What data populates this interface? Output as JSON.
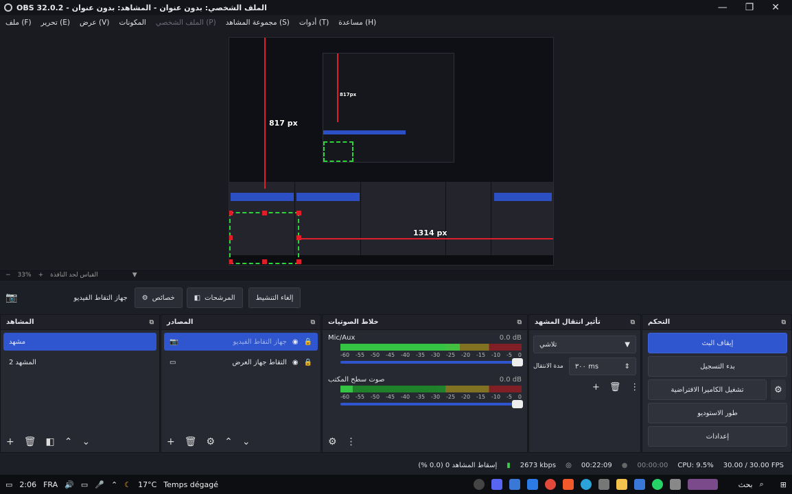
{
  "window": {
    "title": "OBS 32.0.2 - الملف الشخصي: بدون عنوان - المشاهد: بدون عنوان",
    "minimize": "—",
    "maximize": "❐",
    "close": "✕"
  },
  "menu": [
    {
      "label": "ملف (F)",
      "disabled": false
    },
    {
      "label": "تحرير (E)",
      "disabled": false
    },
    {
      "label": "عرض (V)",
      "disabled": false
    },
    {
      "label": "المكونات",
      "disabled": false
    },
    {
      "label": "الملف الشخصي (P)",
      "disabled": true
    },
    {
      "label": "مجموعة المشاهد (S)",
      "disabled": false
    },
    {
      "label": "أدوات (T)",
      "disabled": false
    },
    {
      "label": "مساعدة (H)",
      "disabled": false
    }
  ],
  "preview": {
    "measure_vertical": "817 px",
    "measure_horizontal": "1314 px",
    "inner_measure": "817px"
  },
  "zoom": {
    "minus": "−",
    "value": "33%",
    "plus": "+",
    "fit_label": "القياس لحد النافذة",
    "dropdown": "▼"
  },
  "source_toolbar": {
    "source_name": "جهاز التقاط الفيديو",
    "properties": "خصائص",
    "filters": "المرشحات",
    "deactivate": "إلغاء التنشيط"
  },
  "scenes": {
    "title": "المشاهد",
    "items": [
      {
        "label": "مشهد",
        "selected": true
      },
      {
        "label": "المشهد 2",
        "selected": false
      }
    ]
  },
  "sources": {
    "title": "المصادر",
    "items": [
      {
        "label": "جهاز التقاط الفيديو",
        "selected": true
      },
      {
        "label": "التقاط جهاز العرض",
        "selected": false
      }
    ]
  },
  "mixer": {
    "title": "خلاط الصوتيات",
    "tracks": [
      {
        "name": "Mic/Aux",
        "db": "0.0 dB",
        "level": 0.66
      },
      {
        "name": "صوت سطح المكتب",
        "db": "0.0 dB",
        "level": 0.07
      }
    ],
    "ticks": [
      "-60",
      "-55",
      "-50",
      "-45",
      "-40",
      "-35",
      "-30",
      "-25",
      "-20",
      "-15",
      "-10",
      "-5",
      "0"
    ]
  },
  "transitions": {
    "title": "تأثير انتقال المشهد",
    "type": "تلاشي",
    "duration_label": "مدة الانتقال",
    "duration_value": "٣٠٠ ms"
  },
  "controls": {
    "title": "التحكم",
    "buttons": [
      {
        "label": "إيقاف البث",
        "primary": true
      },
      {
        "label": "بدء التسجيل",
        "primary": false
      },
      {
        "label": "تشغيل الكاميرا الافتراضية",
        "primary": false
      },
      {
        "label": "طور الاستوديو",
        "primary": false
      },
      {
        "label": "إعدادات",
        "primary": false
      }
    ]
  },
  "status": {
    "dropped": "إسقاط المشاهد 0 (0.0 %)",
    "bitrate": "2673 kbps",
    "stream_time": "00:22:09",
    "record_time": "00:00:00",
    "cpu": "CPU: 9.5%",
    "fps": "30.00 / 30.00 FPS"
  },
  "taskbar": {
    "time": "2:06",
    "lang": "FRA",
    "weather_temp": "17°C",
    "weather_text": "Temps dégagé",
    "search": "بحث"
  },
  "colors": {
    "accent": "#2f55cf",
    "measure_line": "#e01e2a",
    "bounding_dash": "#2ed43c"
  }
}
